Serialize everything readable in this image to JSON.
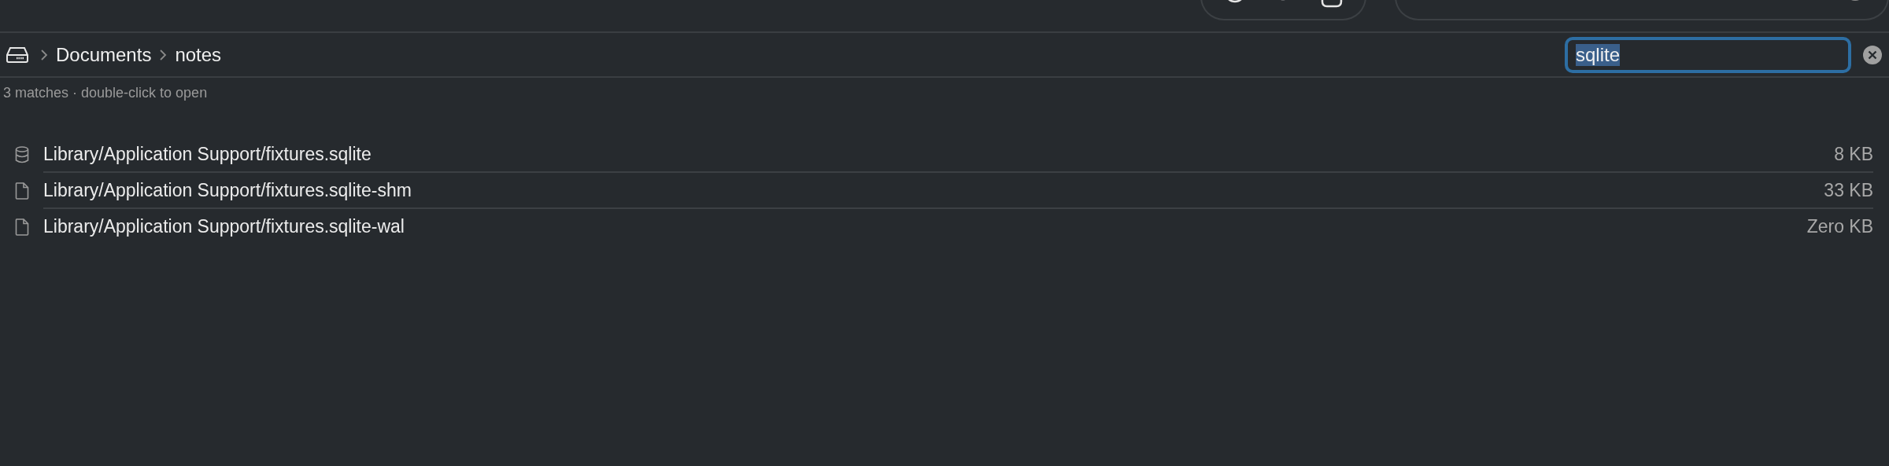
{
  "breadcrumb": [
    {
      "label": "Documents"
    },
    {
      "label": "notes"
    }
  ],
  "search": {
    "value": "sqlite",
    "text_selected": true
  },
  "status": "3 matches · double-click to open",
  "results": [
    {
      "kind": "database",
      "path": "Library/Application Support/fixtures.sqlite",
      "size": "8 KB"
    },
    {
      "kind": "file",
      "path": "Library/Application Support/fixtures.sqlite-shm",
      "size": "33 KB"
    },
    {
      "kind": "file",
      "path": "Library/Application Support/fixtures.sqlite-wal",
      "size": "Zero KB"
    }
  ]
}
